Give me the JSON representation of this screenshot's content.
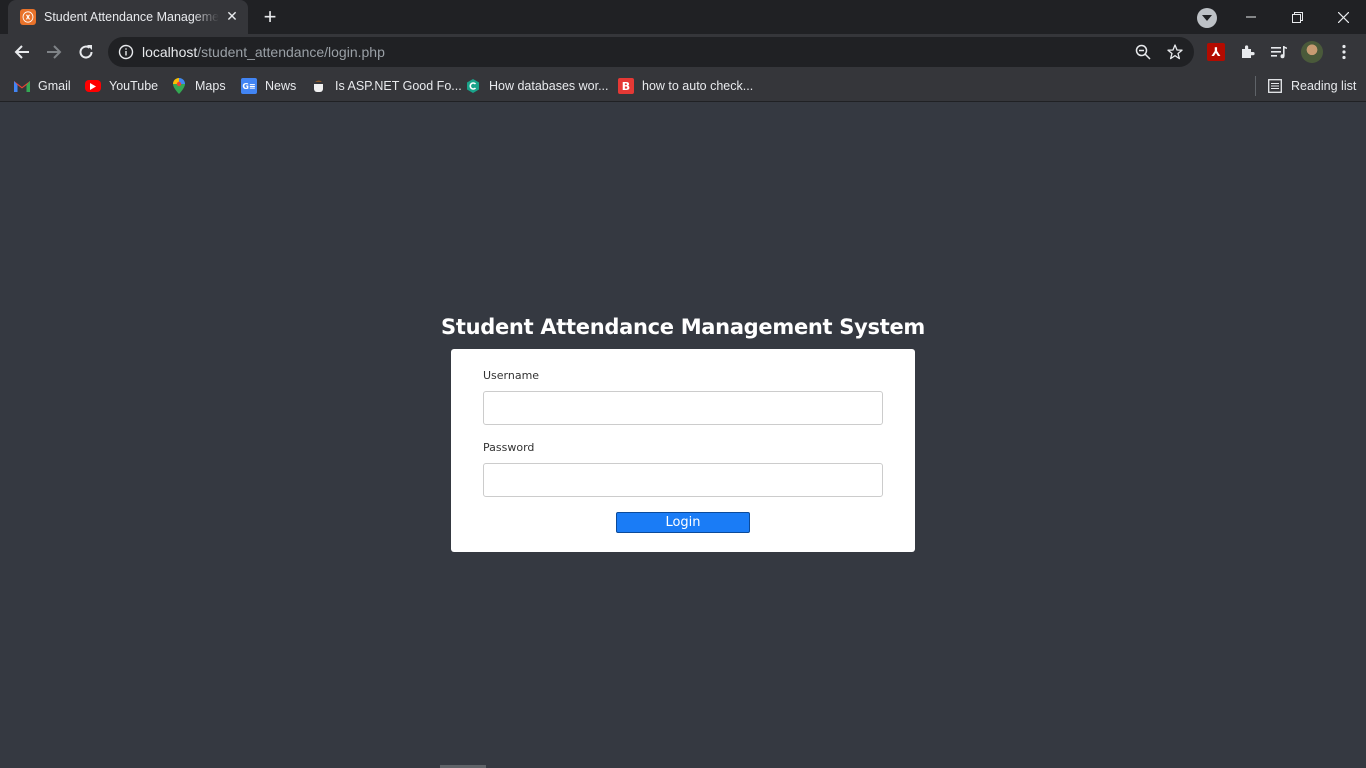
{
  "browser": {
    "tab": {
      "title": "Student Attendance Management System",
      "favicon": "xampp-icon"
    },
    "new_tab_symbol": "+",
    "url_host": "localhost",
    "url_path": "/student_attendance/login.php",
    "bookmarks": [
      {
        "label": "Gmail",
        "icon": "gmail-icon"
      },
      {
        "label": "YouTube",
        "icon": "youtube-icon"
      },
      {
        "label": "Maps",
        "icon": "maps-icon"
      },
      {
        "label": "News",
        "icon": "news-icon"
      },
      {
        "label": "Is ASP.NET Good Fo...",
        "icon": "coffee-icon"
      },
      {
        "label": "How databases wor...",
        "icon": "educative-icon"
      },
      {
        "label": "how to auto check...",
        "icon": "b-icon"
      }
    ],
    "reading_list": "Reading list"
  },
  "page": {
    "title": "Student Attendance Management System",
    "username_label": "Username",
    "username_value": "",
    "password_label": "Password",
    "password_value": "",
    "login_button": "Login"
  },
  "colors": {
    "background": "#353941",
    "card": "#ffffff",
    "button": "#1a7cf6"
  }
}
